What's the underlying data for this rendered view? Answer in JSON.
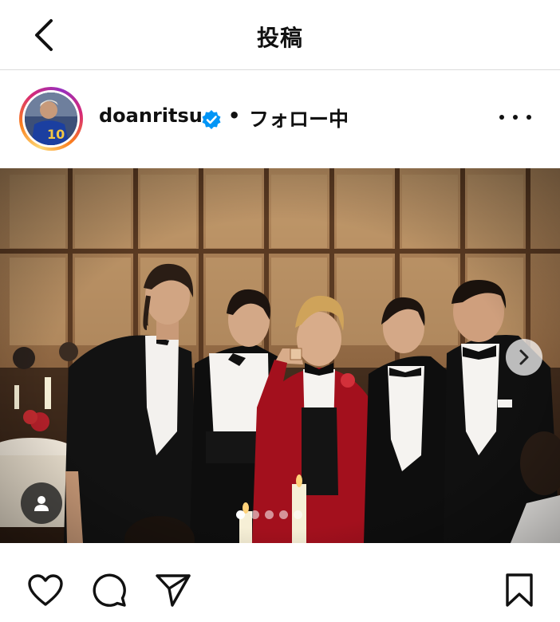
{
  "header": {
    "title": "投稿",
    "back_icon": "chevron-left-icon"
  },
  "post": {
    "username": "doanritsu",
    "verified_icon": "verified-badge-icon",
    "separator": "•",
    "follow_status": "フォロー中",
    "more_icon": "more-horizontal-icon",
    "photo": {
      "description_icon": "photo",
      "carousel_count": 5,
      "carousel_active": 1,
      "next_icon": "chevron-right-icon",
      "tag_icon": "user-tag-icon"
    }
  },
  "actions": {
    "like_icon": "heart-icon",
    "comment_icon": "comment-icon",
    "share_icon": "paper-plane-icon",
    "save_icon": "bookmark-icon"
  },
  "colors": {
    "verified": "#0095f6",
    "story_ring_start": "#feda75",
    "story_ring_end": "#962fbf",
    "suit_red": "#a3101d"
  }
}
